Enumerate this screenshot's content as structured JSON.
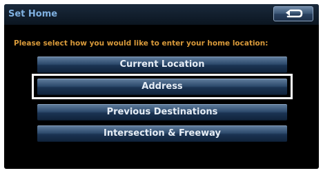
{
  "header": {
    "title": "Set Home",
    "back_icon": "return-arrow-icon"
  },
  "prompt": "Please select how you would like to enter your home location:",
  "options": [
    {
      "label": "Current Location"
    },
    {
      "label": "Address",
      "highlighted": true
    },
    {
      "label": "Previous Destinations"
    },
    {
      "label": "Intersection & Freeway"
    }
  ],
  "colors": {
    "title_text": "#7fb0e0",
    "prompt_text": "#d99a3a",
    "button_text": "#e6edf5",
    "highlight_border": "#ffffff",
    "screen_background": "#000000"
  }
}
